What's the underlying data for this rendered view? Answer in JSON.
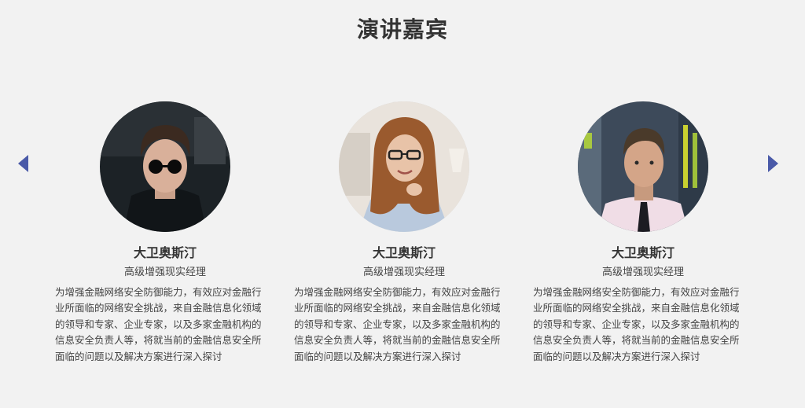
{
  "section": {
    "title": "演讲嘉宾"
  },
  "icons": {
    "prev": "triangle-left-icon",
    "next": "triangle-right-icon"
  },
  "colors": {
    "background": "#f2f2f2",
    "arrow": "#4a5aa8",
    "text": "#333333"
  },
  "speakers": [
    {
      "name": "大卫奥斯汀",
      "title": "高级增强现实经理",
      "description": "为增强金融网络安全防御能力，有效应对金融行业所面临的网络安全挑战，来自金融信息化领域的领导和专家、企业专家，以及多家金融机构的信息安全负责人等，将就当前的金融信息安全所面临的问题以及解决方案进行深入探讨"
    },
    {
      "name": "大卫奥斯汀",
      "title": "高级增强现实经理",
      "description": "为增强金融网络安全防御能力，有效应对金融行业所面临的网络安全挑战，来自金融信息化领域的领导和专家、企业专家，以及多家金融机构的信息安全负责人等，将就当前的金融信息安全所面临的问题以及解决方案进行深入探讨"
    },
    {
      "name": "大卫奥斯汀",
      "title": "高级增强现实经理",
      "description": "为增强金融网络安全防御能力，有效应对金融行业所面临的网络安全挑战，来自金融信息化领域的领导和专家、企业专家，以及多家金融机构的信息安全负责人等，将就当前的金融信息安全所面临的问题以及解决方案进行深入探讨"
    }
  ]
}
